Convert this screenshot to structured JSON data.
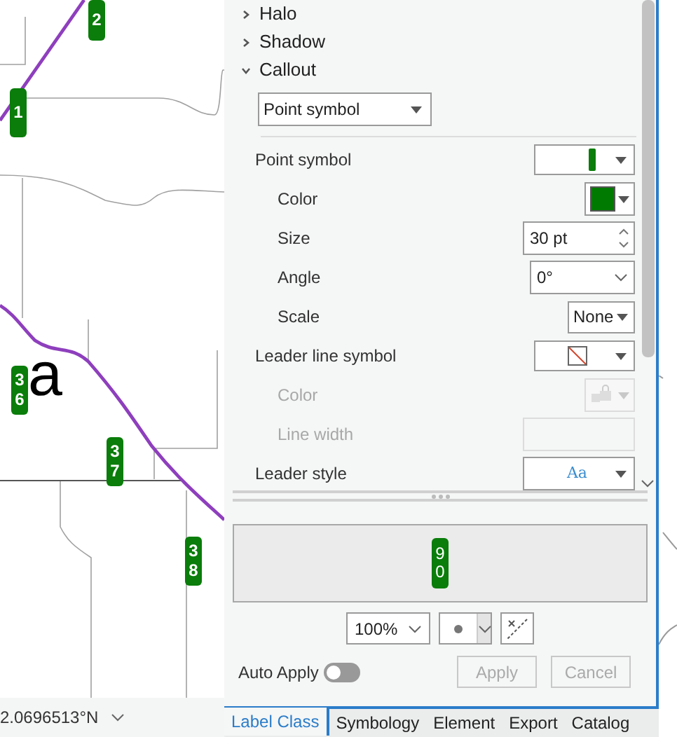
{
  "map": {
    "route_labels": [
      {
        "text": "2"
      },
      {
        "text": "1"
      },
      {
        "text": "36"
      },
      {
        "text": "37"
      },
      {
        "text": "38"
      }
    ],
    "place_label": "a",
    "coordinate": "2.0696513°N"
  },
  "panel": {
    "sections": [
      {
        "label": "Halo",
        "expanded": false
      },
      {
        "label": "Shadow",
        "expanded": false
      },
      {
        "label": "Callout",
        "expanded": true
      }
    ],
    "callout_type": "Point symbol",
    "properties": [
      {
        "kind": "symbol",
        "label": "Point symbol",
        "disabled": false,
        "children": [
          {
            "kind": "color",
            "label": "Color",
            "disabled": false,
            "color": "#007a00"
          },
          {
            "kind": "spinner",
            "label": "Size",
            "disabled": false,
            "value": "30 pt"
          },
          {
            "kind": "combo",
            "label": "Angle",
            "disabled": false,
            "value": "0°"
          },
          {
            "kind": "dropdown",
            "label": "Scale",
            "disabled": false,
            "value": "None"
          }
        ]
      },
      {
        "kind": "line_symbol",
        "label": "Leader line symbol",
        "disabled": false,
        "children": [
          {
            "kind": "color",
            "label": "Color",
            "disabled": true
          },
          {
            "kind": "input",
            "label": "Line width",
            "disabled": true
          }
        ]
      },
      {
        "kind": "text_style",
        "label": "Leader style",
        "disabled": false,
        "value": "Aa"
      }
    ],
    "preview_text": "90",
    "zoom": "100%",
    "auto_apply": {
      "label": "Auto Apply",
      "on": false
    },
    "buttons": [
      {
        "label": "Apply",
        "disabled": true
      },
      {
        "label": "Cancel",
        "disabled": true
      }
    ]
  },
  "tabs": [
    {
      "label": "Label Class",
      "selected": true
    },
    {
      "label": "Symbology",
      "selected": false
    },
    {
      "label": "Element",
      "selected": false
    },
    {
      "label": "Export",
      "selected": false
    },
    {
      "label": "Catalog",
      "selected": false
    }
  ]
}
